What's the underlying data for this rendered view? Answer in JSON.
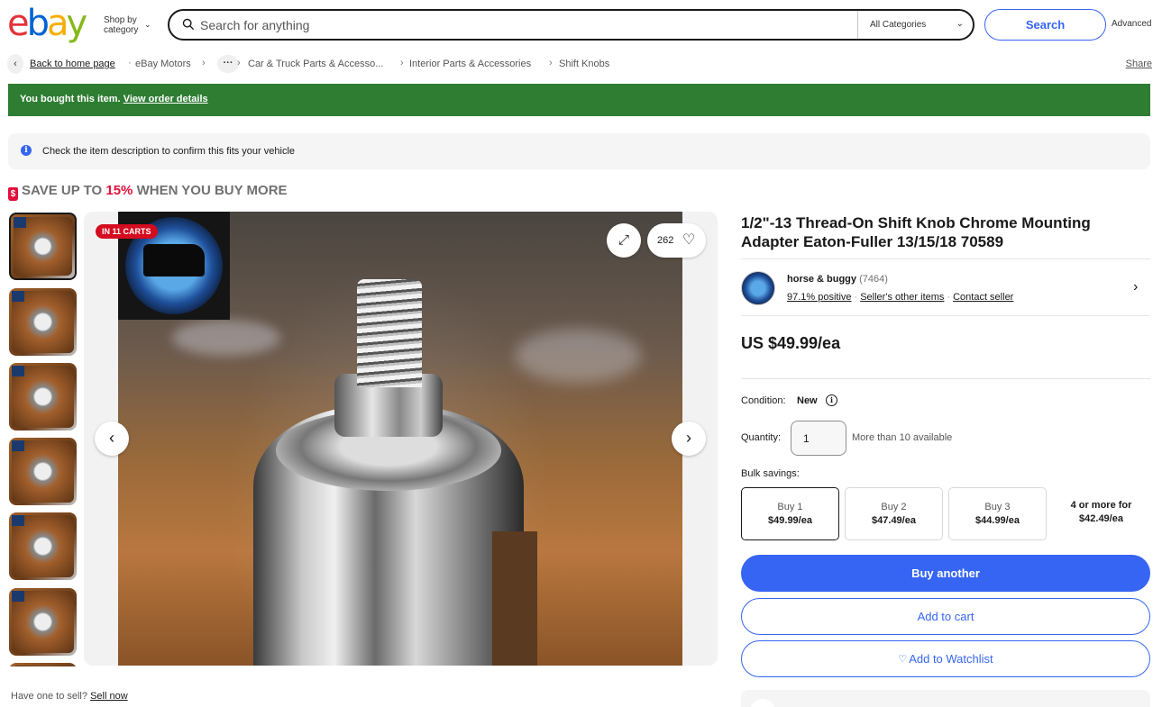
{
  "header": {
    "logo": [
      "e",
      "b",
      "a",
      "y"
    ],
    "logo_colors": [
      "#e53238",
      "#0064d2",
      "#f5af02",
      "#86b817"
    ],
    "shop_by_line1": "Shop by",
    "shop_by_line2": "category",
    "search_placeholder": "Search for anything",
    "category_value": "All Categories",
    "search_button": "Search",
    "advanced": "Advanced"
  },
  "breadcrumb": {
    "back": "Back to home page",
    "items": [
      "eBay Motors",
      "Car & Truck Parts & Accesso...",
      "Interior Parts & Accessories",
      "Shift Knobs"
    ],
    "share": "Share"
  },
  "banner": {
    "bought_text": "You bought this item.",
    "bought_link": "View order details",
    "info_text": "Check the item description to confirm this fits your vehicle"
  },
  "promo": {
    "prefix": "SAVE UP TO ",
    "percent": "15%",
    "suffix": " WHEN YOU BUY MORE"
  },
  "gallery": {
    "in_carts": "IN 11 CARTS",
    "watch_count": "262"
  },
  "item": {
    "title": "1/2\"-13 Thread-On Shift Knob Chrome Mounting Adapter Eaton-Fuller 13/15/18 70589",
    "price": "US $49.99/ea",
    "condition_label": "Condition:",
    "condition_value": "New",
    "quantity_label": "Quantity:",
    "quantity_value": "1",
    "availability": "More than 10 available",
    "bulk_label": "Bulk savings:",
    "bulk": [
      {
        "qty": "Buy 1",
        "price": "$49.99/ea"
      },
      {
        "qty": "Buy 2",
        "price": "$47.49/ea"
      },
      {
        "qty": "Buy 3",
        "price": "$44.99/ea"
      },
      {
        "qty": "4 or more for",
        "price": "$42.49/ea"
      }
    ],
    "buy_button": "Buy another",
    "cart_button": "Add to cart",
    "watch_button": "Add to Watchlist"
  },
  "seller": {
    "name": "horse & buggy",
    "count": "(7464)",
    "feedback": "97.1% positive",
    "other_items": "Seller's other items",
    "contact": "Contact seller"
  },
  "footer": {
    "sell_prompt": "Have one to sell?",
    "sell_link": "Sell now"
  }
}
